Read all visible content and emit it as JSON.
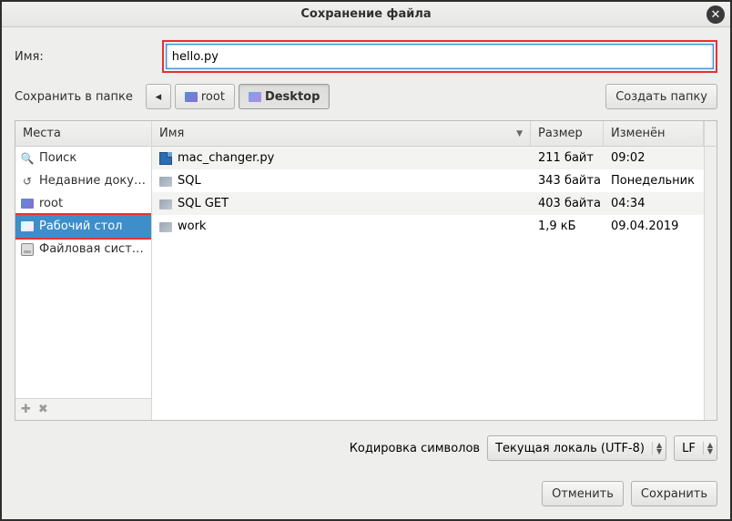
{
  "title": "Сохранение файла",
  "name_label": "Имя:",
  "filename": "hello.py",
  "save_in_label": "Сохранить в папке",
  "path": {
    "root": "root",
    "desktop": "Desktop"
  },
  "create_folder_label": "Создать папку",
  "places_header": "Места",
  "places": [
    {
      "icon": "search",
      "label": "Поиск"
    },
    {
      "icon": "recent",
      "label": "Недавние доку…"
    },
    {
      "icon": "home",
      "label": "root"
    },
    {
      "icon": "desktop",
      "label": "Рабочий стол",
      "selected": true
    },
    {
      "icon": "filesystem",
      "label": "Файловая сист…"
    }
  ],
  "columns": {
    "name": "Имя",
    "size": "Размер",
    "modified": "Изменён"
  },
  "files": [
    {
      "type": "py",
      "name": "mac_changer.py",
      "size": "211 байт",
      "modified": "09:02"
    },
    {
      "type": "folder",
      "name": "SQL",
      "size": "343 байта",
      "modified": "Понедельник"
    },
    {
      "type": "folder",
      "name": "SQL GET",
      "size": "403 байта",
      "modified": "04:34"
    },
    {
      "type": "folder",
      "name": "work",
      "size": "1,9 кБ",
      "modified": "09.04.2019"
    }
  ],
  "encoding_label": "Кодировка символов",
  "encoding_value": "Текущая локаль (UTF-8)",
  "line_ending_value": "LF",
  "cancel_label": "Отменить",
  "save_label": "Сохранить"
}
